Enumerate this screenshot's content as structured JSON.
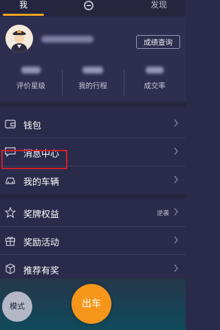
{
  "tabs": {
    "me": "我",
    "discover": "发现"
  },
  "profile": {
    "rating_button": "成绩查询"
  },
  "stats": [
    {
      "label": "评价星级"
    },
    {
      "label": "我的行程"
    },
    {
      "label": "成交率"
    }
  ],
  "menu1": [
    {
      "label": "钱包",
      "icon": "wallet-icon"
    },
    {
      "label": "消息中心",
      "icon": "message-icon"
    },
    {
      "label": "我的车辆",
      "icon": "car-icon"
    }
  ],
  "menu2": [
    {
      "label": "奖牌权益",
      "icon": "star-icon",
      "extra": "逆袭"
    },
    {
      "label": "奖励活动",
      "icon": "gift-icon"
    },
    {
      "label": "推荐有奖",
      "icon": "box-icon"
    }
  ],
  "bottom": {
    "mode": "模式",
    "go": "出车"
  },
  "colors": {
    "accent": "#f5961a",
    "highlight_border": "#d21f2c",
    "bg": "#2a2a4a"
  }
}
